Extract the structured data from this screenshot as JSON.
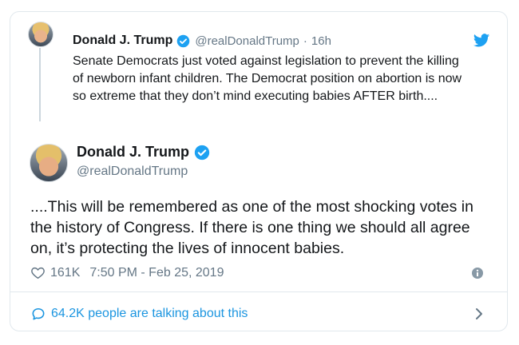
{
  "quoted_tweet": {
    "name": "Donald J. Trump",
    "handle": "@realDonaldTrump",
    "separator": "·",
    "time": "16h",
    "text": "Senate Democrats just voted against legislation to prevent the killing of newborn infant children. The Democrat position on abortion is now so extreme that they don’t mind executing babies AFTER birth...."
  },
  "main_tweet": {
    "name": "Donald J. Trump",
    "handle": "@realDonaldTrump",
    "text": "....This will be remembered as one of the most shocking votes in the history of Congress. If there is one thing we should all agree on, it’s protecting the lives of innocent babies.",
    "likes": "161K",
    "timestamp": "7:50 PM - Feb 25, 2019"
  },
  "footer": {
    "talking_text": "64.2K people are talking about this"
  },
  "colors": {
    "accent": "#1da1f2",
    "link": "#1b95e0",
    "muted": "#657786",
    "border": "#e1e8ed"
  },
  "icons": [
    "verified-badge-icon",
    "twitter-bird-icon",
    "heart-icon",
    "info-icon",
    "speech-bubble-icon",
    "chevron-right-icon"
  ]
}
